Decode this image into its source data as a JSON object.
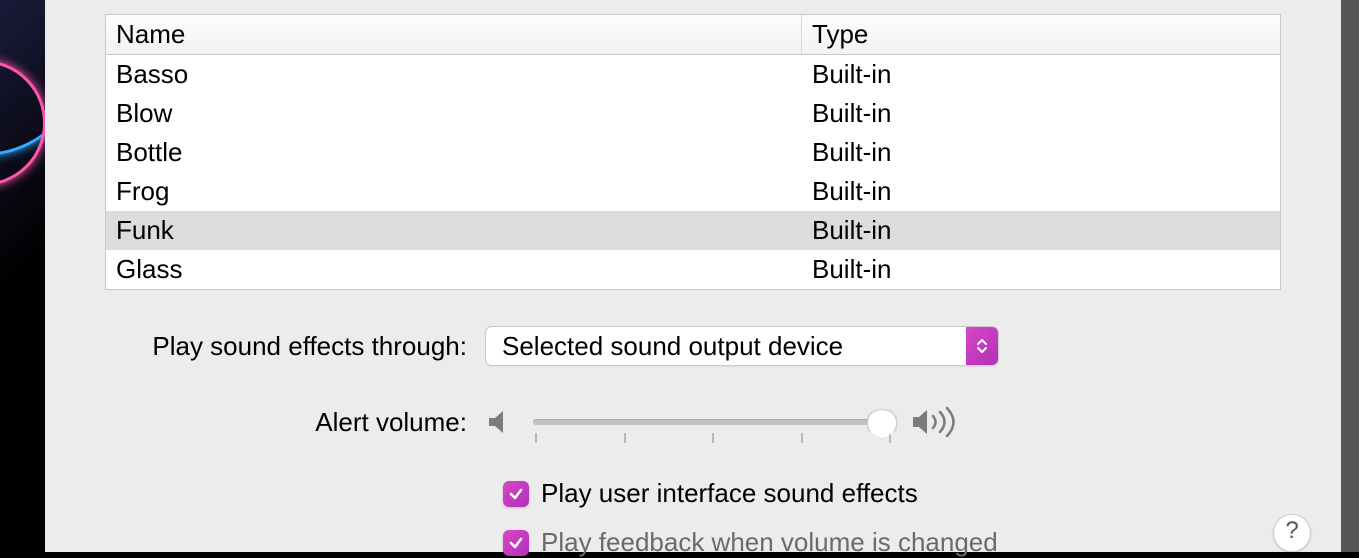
{
  "table": {
    "columns": {
      "name": "Name",
      "type": "Type"
    },
    "rows": [
      {
        "name": "Basso",
        "type": "Built-in",
        "selected": false
      },
      {
        "name": "Blow",
        "type": "Built-in",
        "selected": false
      },
      {
        "name": "Bottle",
        "type": "Built-in",
        "selected": false
      },
      {
        "name": "Frog",
        "type": "Built-in",
        "selected": false
      },
      {
        "name": "Funk",
        "type": "Built-in",
        "selected": true
      },
      {
        "name": "Glass",
        "type": "Built-in",
        "selected": false
      }
    ]
  },
  "output": {
    "label": "Play sound effects through:",
    "value": "Selected sound output device"
  },
  "volume": {
    "label": "Alert volume:",
    "percent": 97
  },
  "checks": {
    "ui_sounds": {
      "label": "Play user interface sound effects",
      "checked": true
    },
    "vol_feedback": {
      "label": "Play feedback when volume is changed",
      "checked": true
    }
  },
  "help": {
    "glyph": "?"
  },
  "colors": {
    "accent": "#c13fbf"
  }
}
